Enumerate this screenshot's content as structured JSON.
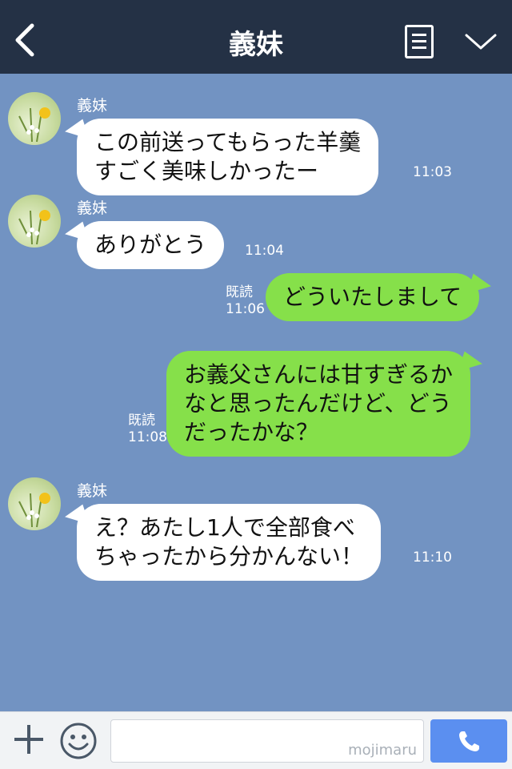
{
  "header": {
    "title": "義妹",
    "back_icon": "chevron-left-icon",
    "menu_icon": "note-icon",
    "collapse_icon": "chevron-down-icon"
  },
  "messages": [
    {
      "side": "in",
      "sender": "義妹",
      "lines": [
        "この前送ってもらった羊羹",
        "すごく美味しかったー"
      ],
      "time": "11:03"
    },
    {
      "side": "in",
      "sender": "義妹",
      "lines": [
        "ありがとう"
      ],
      "time": "11:04"
    },
    {
      "side": "out",
      "read": "既読",
      "lines": [
        "どういたしまして"
      ],
      "time": "11:06"
    },
    {
      "side": "out",
      "read": "既読",
      "lines": [
        "お義父さんには甘すぎるか",
        "なと思ったんだけど、どう",
        "だったかな？"
      ],
      "time": "11:08"
    },
    {
      "side": "in",
      "sender": "義妹",
      "lines": [
        "え？あたし1人で全部食べ",
        "ちゃったから分かんない！"
      ],
      "time": "11:10"
    }
  ],
  "footer": {
    "input_value": "",
    "watermark": "mojimaru",
    "add_icon": "plus-icon",
    "sticker_icon": "smiley-icon",
    "call_icon": "phone-icon"
  },
  "colors": {
    "header_bg": "#243145",
    "chat_bg": "#7293c2",
    "incoming_bubble": "#ffffff",
    "outgoing_bubble": "#86e04a",
    "call_button": "#5b8ff0"
  }
}
